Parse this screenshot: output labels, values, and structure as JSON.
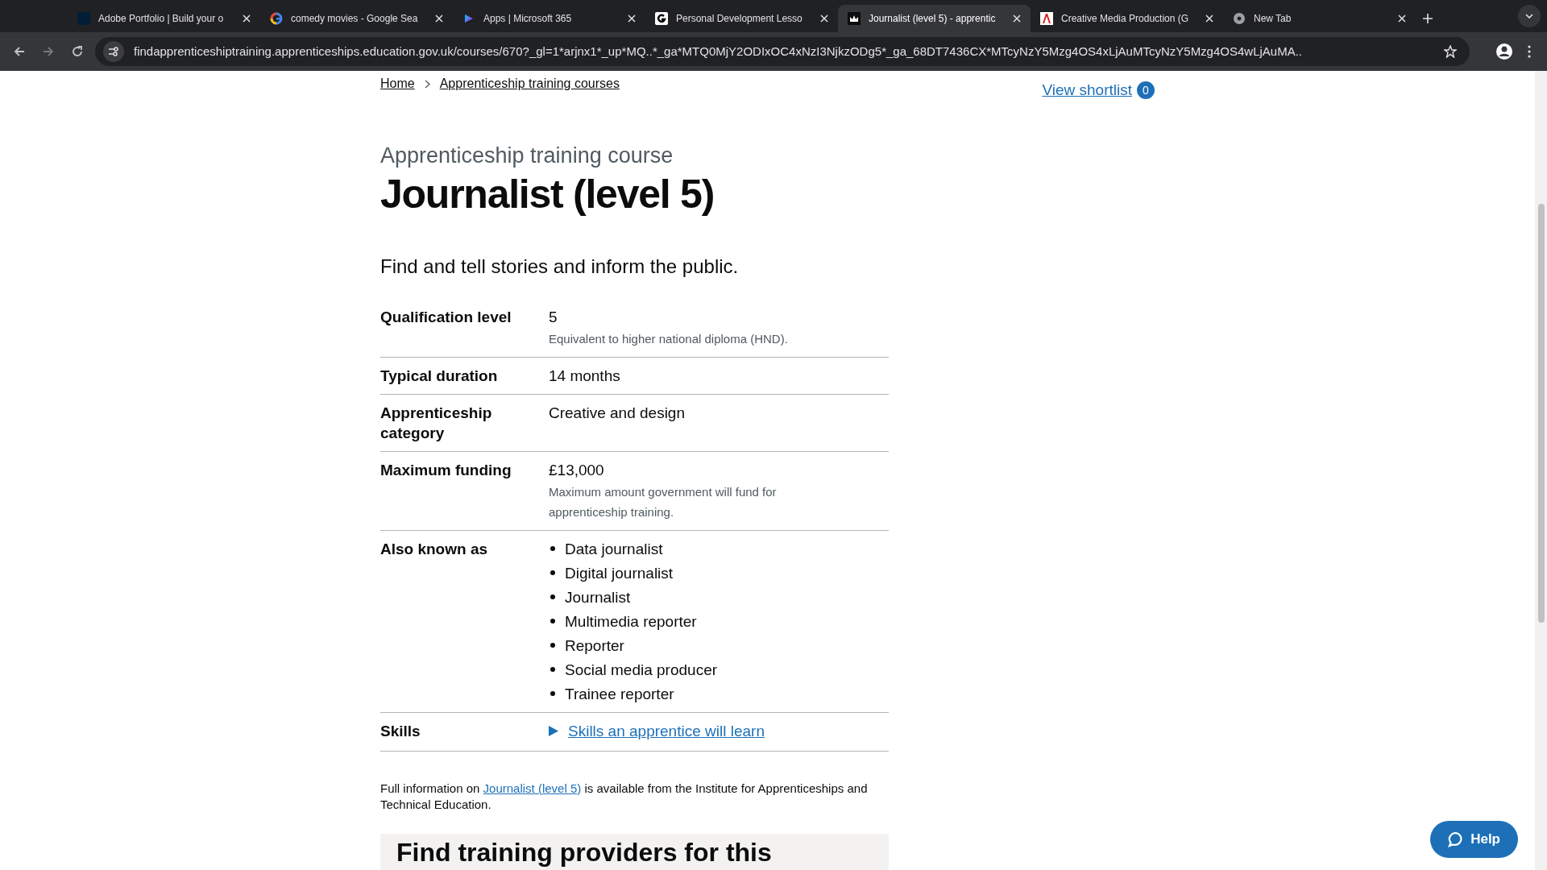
{
  "browser": {
    "tabs": [
      {
        "title": "Adobe Portfolio | Build your o",
        "selected": false
      },
      {
        "title": "comedy movies - Google Sea",
        "selected": false
      },
      {
        "title": "Apps | Microsoft 365",
        "selected": false
      },
      {
        "title": "Personal Development Lesso",
        "selected": false
      },
      {
        "title": "Journalist (level 5) - apprentic",
        "selected": true
      },
      {
        "title": "Creative Media Production (G",
        "selected": false
      },
      {
        "title": "New Tab",
        "selected": false
      }
    ],
    "url": "findapprenticeshiptraining.apprenticeships.education.gov.uk/courses/670?_gl=1*arjnx1*_up*MQ..*_ga*MTQ0MjY2ODIxOC4xNzI3NjkzODg5*_ga_68DT7436CX*MTcyNzY5Mzg4OS4xLjAuMTcyNzY5Mzg4OS4wLjAuMA.."
  },
  "breadcrumbs": [
    "Home",
    "Apprenticeship training courses"
  ],
  "shortlist": {
    "label": "View shortlist",
    "count": "0"
  },
  "caption": "Apprenticeship training course",
  "title": "Journalist (level 5)",
  "lead": "Find and tell stories and inform the public.",
  "summary": [
    {
      "kind": "text",
      "key": "Qualification level",
      "value": "5",
      "hint": "Equivalent to higher national diploma (HND)."
    },
    {
      "kind": "text",
      "key": "Typical duration",
      "value": "14 months"
    },
    {
      "kind": "text",
      "key": "Apprenticeship category",
      "value": "Creative and design"
    },
    {
      "kind": "text",
      "key": "Maximum funding",
      "value": "£13,000",
      "hint": "Maximum amount government will fund for apprenticeship training."
    },
    {
      "kind": "list",
      "key": "Also known as",
      "items": [
        "Data journalist",
        "Digital journalist",
        "Journalist",
        "Multimedia reporter",
        "Reporter",
        "Social media producer",
        "Trainee reporter"
      ]
    },
    {
      "kind": "details",
      "key": "Skills",
      "value": "Skills an apprentice will learn",
      "expanded": false
    }
  ],
  "info": {
    "before": "Full information on",
    "link": "Journalist (level 5)",
    "after": "is available from the Institute for Apprenticeships and Technical Education."
  },
  "providers_heading": "Find training providers for this",
  "help": "Help"
}
